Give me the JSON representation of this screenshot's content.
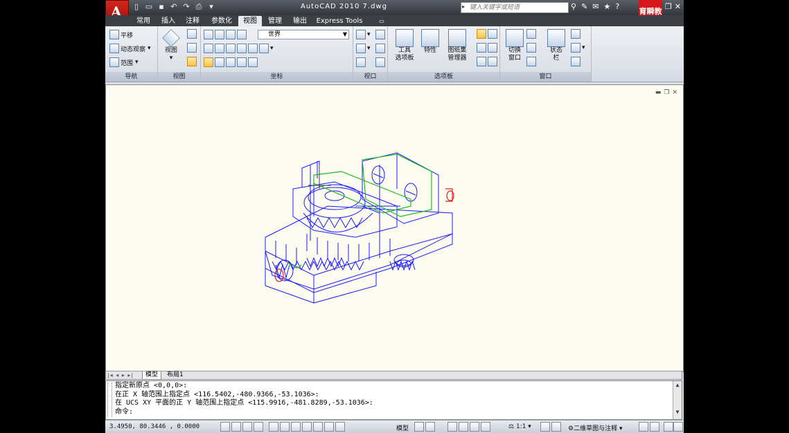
{
  "window": {
    "title": "AutoCAD 2010   7.dwg",
    "search_placeholder": "键入关键字或短语",
    "logo_letter": "A",
    "badge_text": "育瞬教育"
  },
  "tabs": [
    {
      "label": "常用"
    },
    {
      "label": "插入"
    },
    {
      "label": "注释"
    },
    {
      "label": "参数化"
    },
    {
      "label": "视图",
      "active": true
    },
    {
      "label": "管理"
    },
    {
      "label": "输出"
    },
    {
      "label": "Express Tools"
    }
  ],
  "ribbon": {
    "nav": {
      "pan": "平移",
      "orbit": "动态观察",
      "extents": "范围",
      "title": "导航"
    },
    "view": {
      "label": "视图",
      "title": "视图"
    },
    "coords": {
      "ucs_value": "世界",
      "title": "坐标"
    },
    "viewports": {
      "title": "视口"
    },
    "palettes": {
      "tool_palettes": "工具\n选项板",
      "properties": "特性",
      "sheet_set": "图纸集\n管理器",
      "title": "选项板"
    },
    "window": {
      "switch": "切换\n窗口",
      "status": "状态\n栏",
      "title": "窗口"
    }
  },
  "layout_tabs": [
    {
      "label": "模型",
      "active": true
    },
    {
      "label": "布局1"
    }
  ],
  "command_lines": [
    "指定新原点 <0,0,0>:",
    "在正 X 轴范围上指定点 <116.5402,-480.9366,-53.1036>:",
    "在 UCS XY 平面的正 Y 轴范围上指定点 <115.9916,-481.8289,-53.1036>:",
    "命令:"
  ],
  "status": {
    "coordinates": "3.4950,  80.3446  , 0.0000",
    "model": "模型",
    "scale": "1:1",
    "workspace": "二维草图与注释"
  },
  "colors": {
    "model_outline": "#1a1aff",
    "green_part": "#22bb22",
    "red_part": "#dd2222",
    "canvas": "#fbfbf0"
  }
}
